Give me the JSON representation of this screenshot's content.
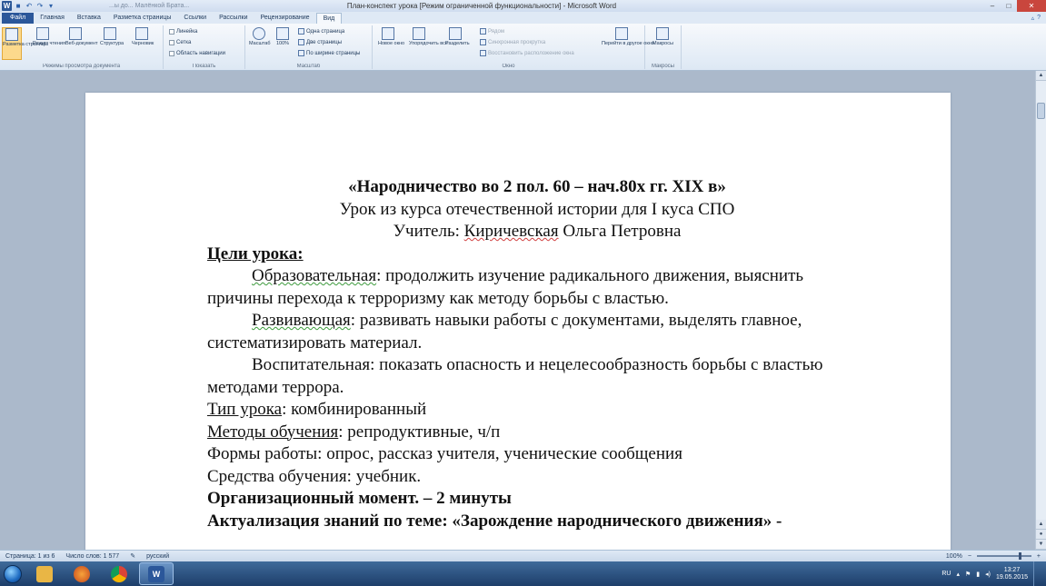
{
  "window": {
    "title": "План-конспект урока [Режим ограниченной функциональности] - Microsoft Word",
    "recent": "...ы до... Малёнкой Брата...",
    "controls": {
      "minimize": "–",
      "maximize": "□",
      "close": "✕"
    }
  },
  "quick_access": {
    "logo": "W",
    "save": "■",
    "undo": "↶",
    "redo": "↷",
    "customize": "▾"
  },
  "ribbon": {
    "tabs": [
      {
        "label": "Файл",
        "kind": "file"
      },
      {
        "label": "Главная",
        "kind": "normal"
      },
      {
        "label": "Вставка",
        "kind": "normal"
      },
      {
        "label": "Разметка страницы",
        "kind": "normal"
      },
      {
        "label": "Ссылки",
        "kind": "normal"
      },
      {
        "label": "Рассылки",
        "kind": "normal"
      },
      {
        "label": "Рецензирование",
        "kind": "normal"
      },
      {
        "label": "Вид",
        "kind": "active"
      }
    ],
    "tabs_right": {
      "minimize_ribbon": "▵",
      "help": "?"
    },
    "groups": {
      "views": {
        "label": "Режимы просмотра документа",
        "buttons": [
          "Разметка страницы",
          "Режим чтения",
          "Веб-документ",
          "Структура",
          "Черновик"
        ]
      },
      "show": {
        "label": "Показать",
        "items": [
          "Линейка",
          "Сетка",
          "Область навигации"
        ]
      },
      "zoom": {
        "label": "Масштаб",
        "big": [
          "Масштаб",
          "100%"
        ],
        "small": [
          "Одна страница",
          "Две страницы",
          "По ширине страницы"
        ]
      },
      "window": {
        "label": "Окно",
        "big": [
          "Новое окно",
          "Упорядочить все",
          "Разделить"
        ],
        "small": [
          "Рядом",
          "Синхронная прокрутка",
          "Восстановить расположение окна"
        ],
        "switch": "Перейти в другое окно"
      },
      "macros": {
        "label": "Макросы",
        "big": "Макросы"
      }
    }
  },
  "document": {
    "title": "«Народничество во 2  пол. 60 – нач.80х гг. XIX в»",
    "subtitle": "Урок из курса отечественной истории для I куса СПО",
    "teacher_prefix": "Учитель: ",
    "teacher_name": "Киричевская",
    "teacher_rest": " Ольга Петровна",
    "goals_heading": "Цели урока:",
    "goal1_label": "Образовательная",
    "goal1_text": ": продолжить изучение радикального движения, выяснить причины перехода к терроризму как методу борьбы с властью.",
    "goal2_label": "Развивающая",
    "goal2_text": ": развивать навыки работы с документами, выделять главное, систематизировать  материал.",
    "goal3_text": "Воспитательная: показать  опасность и нецелесообразность борьбы с властью методами террора.",
    "type_label": "Тип урока",
    "type_text": ": комбинированный",
    "methods_label": "Методы обучения",
    "methods_text": ": репродуктивные, ч/п",
    "forms": "Формы работы: опрос, рассказ учителя, ученические сообщения",
    "means": "Средства обучения: учебник.",
    "org_moment": "Организационный момент. – 2 минуты",
    "actualization": "Актуализация знаний по теме: «Зарождение народнического  движения» -"
  },
  "statusbar": {
    "page": "Страница: 1 из 6",
    "words": "Число слов: 1 577",
    "lang": "русский",
    "zoom": "100%",
    "zoom_minus": "−",
    "zoom_plus": "+"
  },
  "taskbar": {
    "apps": [
      "Проводник",
      "Firefox",
      "Chrome",
      "Word"
    ],
    "tray_lang": "RU",
    "time": "13:27",
    "date": "19.05.2015"
  },
  "colors": {
    "accent": "#2b579a",
    "workspace": "#abb9cb",
    "taskbar": "#1d3e6a"
  }
}
